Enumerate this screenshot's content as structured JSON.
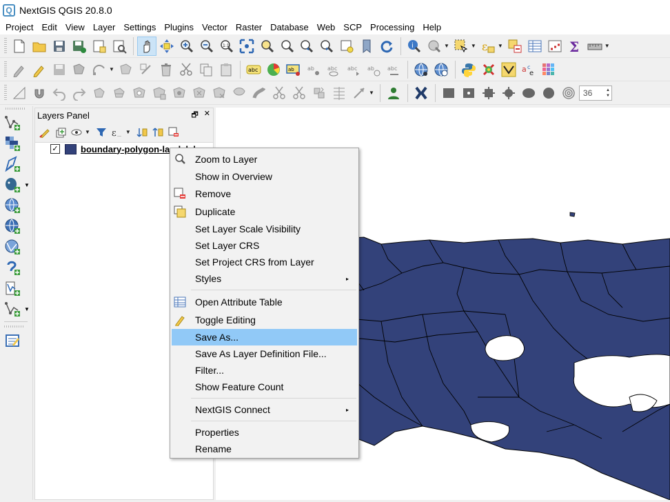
{
  "window": {
    "title": "NextGIS QGIS 20.8.0",
    "logo_icon": "qgis-logo-icon"
  },
  "menubar": [
    "Project",
    "Edit",
    "View",
    "Layer",
    "Settings",
    "Plugins",
    "Vector",
    "Raster",
    "Database",
    "Web",
    "SCP",
    "Processing",
    "Help"
  ],
  "toolbar": {
    "scale_value": "36"
  },
  "layers_panel": {
    "title": "Layers Panel",
    "float_icon": "🗗",
    "close_icon": "✕",
    "layer": {
      "name": "boundary-polygon-land_lvl",
      "checked": "✓",
      "color": "#33427a"
    }
  },
  "context_menu": {
    "items": [
      {
        "label": "Zoom to Layer",
        "icon": "zoom-icon"
      },
      {
        "label": "Show in Overview"
      },
      {
        "label": "Remove",
        "icon": "remove-icon"
      },
      {
        "label": "Duplicate",
        "icon": "duplicate-icon"
      },
      {
        "label": "Set Layer Scale Visibility"
      },
      {
        "label": "Set Layer CRS"
      },
      {
        "label": "Set Project CRS from Layer"
      },
      {
        "label": "Styles",
        "submenu": "▸"
      },
      {
        "label": "Open Attribute Table",
        "icon": "table-icon"
      },
      {
        "label": "Toggle Editing",
        "icon": "pencil-icon"
      },
      {
        "label": "Save As...",
        "highlighted": true
      },
      {
        "label": "Save As Layer Definition File..."
      },
      {
        "label": "Filter..."
      },
      {
        "label": "Show Feature Count"
      },
      {
        "label": "NextGIS Connect",
        "submenu": "▸"
      },
      {
        "label": "Properties"
      },
      {
        "label": "Rename"
      }
    ]
  },
  "colors": {
    "map_fill": "#33427a",
    "map_stroke": "#000000",
    "highlight": "#91c9f7"
  }
}
